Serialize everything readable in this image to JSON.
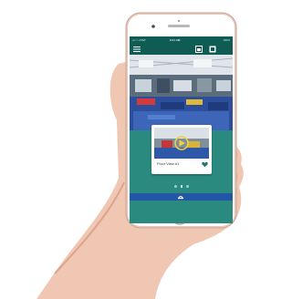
{
  "status_bar": {
    "carrier": "•••○○ AT&T",
    "time": "9:41 AM",
    "battery": "100%"
  },
  "header": {
    "menu_icon": "menu-icon",
    "icons": [
      "image-icon",
      "grid-icon"
    ]
  },
  "card": {
    "title": "Floor View #1",
    "favorite_icon": "heart-icon"
  },
  "carousel": {
    "pages": 3,
    "active_index": 1
  },
  "footer": {
    "icon": "gym-logo-icon"
  },
  "colors": {
    "header": "#0f5c55",
    "screen": "#2a8a80",
    "footer": "#2456a6",
    "accent": "#1e7a6f"
  }
}
